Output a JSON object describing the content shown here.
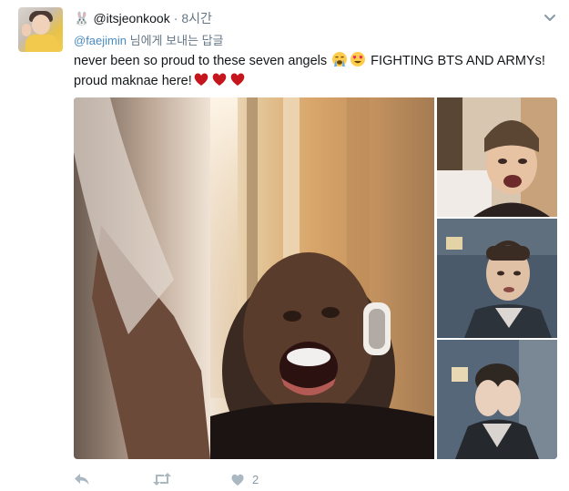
{
  "tweet": {
    "handle": "@itsjeonkook",
    "separator": "·",
    "time": "8시간",
    "reply_prefix": "@faejimin",
    "reply_suffix": " 님에게 보내는 답글",
    "text_line1": "never been so proud to these seven angels ",
    "text_line1_after": " FIGHTING BTS AND ARMYs!",
    "text_line2": "proud maknae here!",
    "icons": {
      "header": "rabbit-icon",
      "menu": "chevron-down-icon",
      "emojis_line1": [
        "loudly-crying-face-icon",
        "heart-eyes-icon"
      ],
      "emojis_line2": [
        "red-heart-icon",
        "red-heart-icon",
        "red-heart-icon"
      ]
    }
  },
  "actions": {
    "reply_icon": "reply-icon",
    "retweet_icon": "retweet-icon",
    "like_icon": "heart-icon",
    "like_count": "2"
  },
  "colors": {
    "accent_link": "#4a8bc2",
    "muted": "#657786",
    "action_grey": "#8899a6",
    "heart_red": "#c4161c"
  }
}
